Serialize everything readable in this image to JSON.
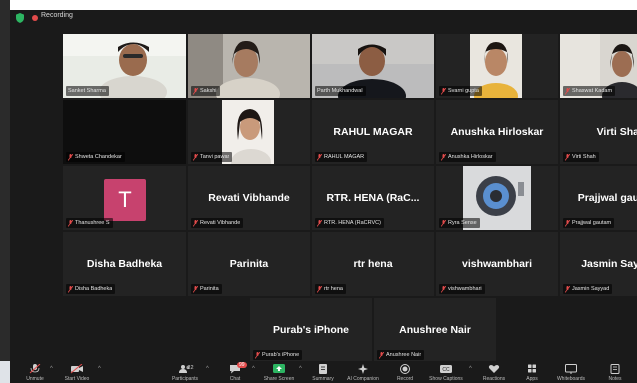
{
  "topbar": {
    "recording_label": "Recording"
  },
  "participants": [
    {
      "id": "p1",
      "name": "Sanket Sharma",
      "type": "video",
      "active": true
    },
    {
      "id": "p2",
      "name": "Sakshi",
      "type": "video"
    },
    {
      "id": "p3",
      "name": "Parth Mukhandwal",
      "type": "video"
    },
    {
      "id": "p4",
      "name": "Svarni gupta",
      "type": "video"
    },
    {
      "id": "p5",
      "name": "Shaswat Kadam",
      "type": "video"
    },
    {
      "id": "p6",
      "name": "Shweta Chandekar",
      "type": "blank"
    },
    {
      "id": "p7",
      "name": "Tanvi pawar",
      "type": "video"
    },
    {
      "id": "p8",
      "name": "RAHUL MAGAR",
      "display": "RAHUL MAGAR",
      "type": "name"
    },
    {
      "id": "p9",
      "name": "Anushka Hirloskar",
      "display": "Anushka Hirloskar",
      "type": "name"
    },
    {
      "id": "p10",
      "name": "Virti Shah",
      "display": "Virti Sha",
      "type": "name"
    },
    {
      "id": "p11",
      "name": "Thanushree S",
      "type": "avatar",
      "avatar_letter": "T",
      "avatar_color": "#c7426e"
    },
    {
      "id": "p12",
      "name": "Revati Vibhande",
      "display": "Revati Vibhande",
      "type": "name"
    },
    {
      "id": "p13",
      "name": "RTR. HENA (RaCRVC)",
      "display": "RTR. HENA (RaC...",
      "type": "name"
    },
    {
      "id": "p14",
      "name": "Ryra Sense",
      "type": "video"
    },
    {
      "id": "p15",
      "name": "Prajjwal gautam",
      "display": "Prajjwal gau",
      "type": "name"
    },
    {
      "id": "p16",
      "name": "Disha Badheka",
      "display": "Disha Badheka",
      "type": "name"
    },
    {
      "id": "p17",
      "name": "Parinita",
      "display": "Parinita",
      "type": "name"
    },
    {
      "id": "p18",
      "name": "rtr hena",
      "display": "rtr hena",
      "type": "name"
    },
    {
      "id": "p19",
      "name": "vishwambhari",
      "display": "vishwambhari",
      "type": "name"
    },
    {
      "id": "p20",
      "name": "Jasmin Sayyad",
      "display": "Jasmin Say",
      "type": "name"
    },
    {
      "id": "p21",
      "name": "Purab's iPhone",
      "display": "Purab's iPhone",
      "type": "name"
    },
    {
      "id": "p22",
      "name": "Anushree Nair",
      "display": "Anushree Nair",
      "type": "name"
    }
  ],
  "toolbar": {
    "mute": "Unmute",
    "video": "Start Video",
    "participants": "Participants",
    "participants_count": "22",
    "chat": "Chat",
    "chat_badge": "99",
    "share": "Share Screen",
    "summary": "Summary",
    "ai": "AI Companion",
    "record": "Record",
    "captions": "Show Captions",
    "reactions": "Reactions",
    "apps": "Apps",
    "whiteboards": "Whiteboards",
    "notes": "Notes"
  },
  "colors": {
    "active_border": "#c8e36b",
    "record_red": "#e34b4b",
    "share_green": "#2db562"
  }
}
